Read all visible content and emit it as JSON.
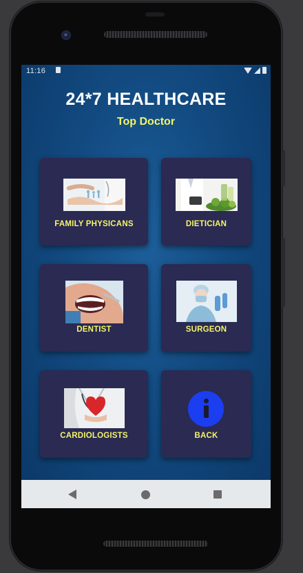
{
  "status_bar": {
    "time": "11:16"
  },
  "app": {
    "title": "24*7 HEALTHCARE",
    "subtitle": "Top Doctor"
  },
  "cards": [
    {
      "label": "FAMILY PHYSICANS",
      "image": "family-care-photo"
    },
    {
      "label": "DIETICIAN",
      "image": "doctor-with-vegetables-photo"
    },
    {
      "label": "DENTIST",
      "image": "dental-exam-photo"
    },
    {
      "label": "SURGEON",
      "image": "surgeon-photo"
    },
    {
      "label": "CARDIOLOGISTS",
      "image": "heart-in-hand-photo"
    },
    {
      "label": "BACK",
      "image": "info-icon"
    }
  ],
  "colors": {
    "background": "#124a80",
    "card": "#2a2a52",
    "label": "#f5f56a",
    "title": "#ffffff",
    "info_icon": "#1b3ef0"
  }
}
